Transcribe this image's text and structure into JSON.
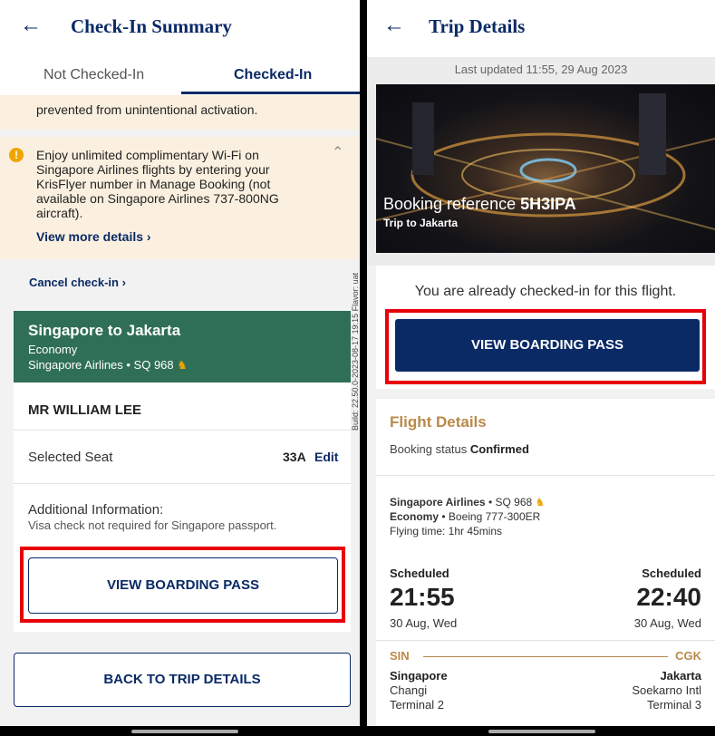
{
  "left": {
    "title": "Check-In Summary",
    "tabs": [
      "Not Checked-In",
      "Checked-In"
    ],
    "truncated_note": "prevented from unintentional activation.",
    "wifi_notice": "Enjoy unlimited complimentary Wi-Fi on Singapore Airlines flights by entering your KrisFlyer number in Manage Booking (not available on Singapore Airlines 737-800NG aircraft).",
    "view_more": "View more details ›",
    "cancel_checkin": "Cancel check-in ›",
    "flight": {
      "route": "Singapore to Jakarta",
      "cabin": "Economy",
      "carrier": "Singapore Airlines • SQ 968"
    },
    "passenger": "MR WILLIAM LEE",
    "seat_label": "Selected Seat",
    "seat_value": "33A",
    "seat_edit": "Edit",
    "addl_title": "Additional Information:",
    "addl_text": "Visa check not required for Singapore passport.",
    "boarding_btn": "VIEW BOARDING PASS",
    "back_btn": "BACK TO TRIP DETAILS",
    "build_watermark": "Build: 22.50.0-2023-08-17 19:15 Flavor: uat"
  },
  "right": {
    "title": "Trip Details",
    "last_updated": "Last updated 11:55, 29 Aug 2023",
    "booking_ref_label": "Booking reference",
    "booking_ref": "5H3IPA",
    "trip_name": "Trip to Jakarta",
    "checked_msg": "You are already checked-in for this flight.",
    "boarding_btn": "VIEW BOARDING PASS",
    "flight_details_title": "Flight Details",
    "booking_status_label": "Booking status",
    "booking_status": "Confirmed",
    "carrier": "Singapore Airlines",
    "flight_no": "• SQ 968",
    "cabin": "Economy",
    "aircraft": "• Boeing 777-300ER",
    "flying_time": "Flying time: 1hr 45mins",
    "dep": {
      "label": "Scheduled",
      "time": "21:55",
      "date": "30 Aug, Wed",
      "code": "SIN",
      "city": "Singapore",
      "airport": "Changi",
      "terminal": "Terminal 2"
    },
    "arr": {
      "label": "Scheduled",
      "time": "22:40",
      "date": "30 Aug, Wed",
      "code": "CGK",
      "city": "Jakarta",
      "airport": "Soekarno Intl",
      "terminal": "Terminal 3"
    }
  },
  "colors": {
    "navy": "#0a2a66",
    "green": "#2f6f55",
    "gold": "#b98a4a",
    "highlight": "#e8000b",
    "note_bg": "#fbf0df"
  }
}
